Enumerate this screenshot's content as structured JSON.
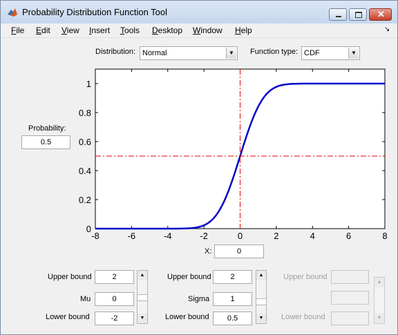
{
  "window": {
    "title": "Probability Distribution Function Tool"
  },
  "menu": {
    "items": [
      {
        "key": "F",
        "rest": "ile"
      },
      {
        "key": "E",
        "rest": "dit"
      },
      {
        "key": "V",
        "rest": "iew"
      },
      {
        "key": "I",
        "rest": "nsert"
      },
      {
        "key": "T",
        "rest": "ools"
      },
      {
        "key": "D",
        "rest": "esktop"
      },
      {
        "key": "W",
        "rest": "indow"
      },
      {
        "key": "H",
        "rest": "elp"
      }
    ]
  },
  "controls": {
    "distribution_label": "Distribution:",
    "distribution_value": "Normal",
    "function_type_label": "Function type:",
    "function_type_value": "CDF",
    "probability_label": "Probability:",
    "probability_value": "0.5",
    "x_label": "X:",
    "x_value": "0"
  },
  "params": {
    "p1": {
      "upper_label": "Upper bound",
      "upper_value": "2",
      "name": "Mu",
      "value": "0",
      "lower_label": "Lower bound",
      "lower_value": "-2"
    },
    "p2": {
      "upper_label": "Upper bound",
      "upper_value": "2",
      "name": "Sigma",
      "value": "1",
      "lower_label": "Lower bound",
      "lower_value": "0.5"
    },
    "p3": {
      "upper_label": "Upper bound",
      "upper_value": "",
      "name": "",
      "value": "",
      "lower_label": "Lower bound",
      "lower_value": "",
      "enabled": false
    }
  },
  "chart_data": {
    "type": "line",
    "function": "normal_cdf",
    "mu": 0,
    "sigma": 1,
    "xlim": [
      -8,
      8
    ],
    "ylim": [
      0,
      1.1
    ],
    "xticks": [
      -8,
      -6,
      -4,
      -2,
      0,
      2,
      4,
      6,
      8
    ],
    "yticks": [
      0,
      0.2,
      0.4,
      0.6,
      0.8,
      1
    ],
    "x_ticklabels": [
      "-8",
      "-6",
      "-4",
      "-2",
      "0",
      "2",
      "4",
      "6",
      "8"
    ],
    "y_ticklabels": [
      "0",
      "0.2",
      "0.4",
      "0.6",
      "0.8",
      "1"
    ],
    "crosshair": {
      "x": 0,
      "y": 0.5
    },
    "colors": {
      "curve": "#0000cc",
      "crosshair": "#e00000"
    }
  }
}
